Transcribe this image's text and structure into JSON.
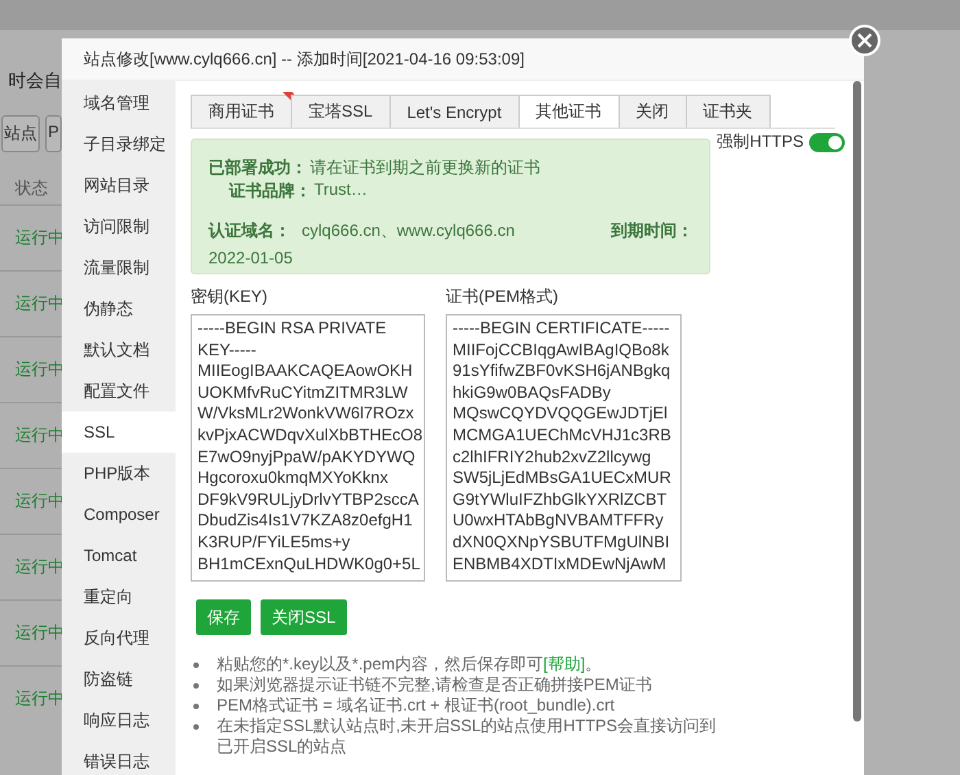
{
  "background": {
    "banner_text": "时会自",
    "buttons": [
      "站点",
      "P"
    ],
    "column_header": "状态",
    "rows": [
      {
        "status": "运行中"
      },
      {
        "status": "运行中"
      },
      {
        "status": "运行中"
      },
      {
        "status": "运行中"
      },
      {
        "status": "运行中"
      },
      {
        "status": "运行中"
      },
      {
        "status": "运行中"
      },
      {
        "status": "运行中"
      }
    ]
  },
  "dialog": {
    "title": "站点修改[www.cylq666.cn] -- 添加时间[2021-04-16 09:53:09]",
    "sidebar": {
      "items": [
        {
          "label": "域名管理",
          "selected": false
        },
        {
          "label": "子目录绑定",
          "selected": false
        },
        {
          "label": "网站目录",
          "selected": false
        },
        {
          "label": "访问限制",
          "selected": false
        },
        {
          "label": "流量限制",
          "selected": false
        },
        {
          "label": "伪静态",
          "selected": false
        },
        {
          "label": "默认文档",
          "selected": false
        },
        {
          "label": "配置文件",
          "selected": false
        },
        {
          "label": "SSL",
          "selected": true
        },
        {
          "label": "PHP版本",
          "selected": false
        },
        {
          "label": "Composer",
          "selected": false
        },
        {
          "label": "Tomcat",
          "selected": false
        },
        {
          "label": "重定向",
          "selected": false
        },
        {
          "label": "反向代理",
          "selected": false
        },
        {
          "label": "防盗链",
          "selected": false
        },
        {
          "label": "响应日志",
          "selected": false
        },
        {
          "label": "错误日志",
          "selected": false
        }
      ]
    },
    "tabs": [
      {
        "label": "商用证书",
        "selected": false,
        "ribbon": true
      },
      {
        "label": "宝塔SSL",
        "selected": false,
        "ribbon": false
      },
      {
        "label": "Let's Encrypt",
        "selected": false,
        "ribbon": false
      },
      {
        "label": "其他证书",
        "selected": true,
        "ribbon": false
      },
      {
        "label": "关闭",
        "selected": false,
        "ribbon": false
      },
      {
        "label": "证书夹",
        "selected": false,
        "ribbon": false
      }
    ],
    "force_https": {
      "label": "强制HTTPS",
      "on": true
    },
    "status_box": {
      "deployed_label": "已部署成功：",
      "deployed_text": "请在证书到期之前更换新的证书",
      "brand_label": "证书品牌：",
      "brand_value": "Trust…",
      "domain_label": "认证域名：",
      "domain_value": "cylq666.cn、www.cylq666.cn",
      "expiry_label": "到期时间：",
      "expiry_value": "2022-01-05"
    },
    "key": {
      "label": "密钥(KEY)",
      "value": "-----BEGIN RSA PRIVATE\nKEY-----\nMIIEogIBAAKCAQEAowOKH\nUOKMfvRuCYitmZITMR3LW\nW/VksMLr2WonkVW6l7ROzx\nkvPjxACWDqvXulXbBTHEcO8\nE7wO9nyjPpaW/pAKYDYWQ\nHgcoroxu0kmqMXYoKknx\nDF9kV9RULjyDrlvYTBP2sccA\nDbudZis4Is1V7KZA8z0efgH1\nK3RUP/FYiLE5ms+y\nBH1mCExnQuLHDWK0g0+5L"
    },
    "certificate": {
      "label": "证书(PEM格式)",
      "value": "-----BEGIN CERTIFICATE-----\nMIIFojCCBIqgAwIBAgIQBo8k\n91sYfifwZBF0vKSH6jANBgkq\nhkiG9w0BAQsFADBy\nMQswCQYDVQQGEwJDTjEl\nMCMGA1UEChMcVHJ1c3RB\nc2lhIFRIY2hub2xvZ2llcywg\nSW5jLjEdMBsGA1UECxMUR\nG9tYWluIFZhbGlkYXRlZCBT\nU0wxHTAbBgNVBAMTFFRy\ndXN0QXNpYSBUTFMgUlNBI\nENBMB4XDTIxMDEwNjAwM"
    },
    "buttons": [
      {
        "label": "保存"
      },
      {
        "label": "关闭SSL"
      }
    ],
    "notes": [
      {
        "before": "粘贴您的*.key以及*.pem内容，然后保存即可",
        "link": "[帮助]",
        "after": "。"
      },
      {
        "before": "如果浏览器提示证书链不完整,请检查是否正确拼接PEM证书"
      },
      {
        "before": "PEM格式证书 = 域名证书.crt + 根证书(root_bundle).crt"
      },
      {
        "before": "在未指定SSL默认站点时,未开启SSL的站点使用HTTPS会直接访问到已开启SSL的站点"
      }
    ]
  }
}
